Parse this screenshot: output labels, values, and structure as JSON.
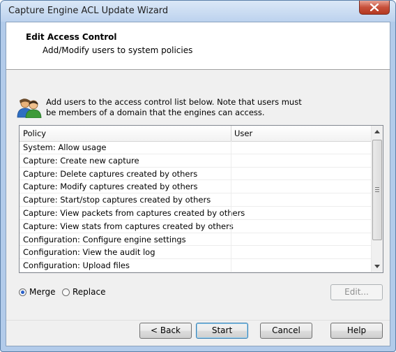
{
  "window": {
    "title": "Capture Engine ACL Update Wizard",
    "close_icon": "close-icon"
  },
  "header": {
    "title": "Edit Access Control",
    "subtitle": "Add/Modify users to system policies"
  },
  "info": {
    "icon": "users-icon",
    "text": "Add users to the access control list below. Note that users must be members of a domain that the engines can access."
  },
  "table": {
    "columns": [
      "Policy",
      "User"
    ],
    "rows": [
      {
        "policy": "System: Allow usage",
        "user": ""
      },
      {
        "policy": "Capture: Create new capture",
        "user": ""
      },
      {
        "policy": "Capture: Delete captures created by others",
        "user": ""
      },
      {
        "policy": "Capture: Modify captures created by others",
        "user": ""
      },
      {
        "policy": "Capture: Start/stop captures created by others",
        "user": ""
      },
      {
        "policy": "Capture: View packets from captures created by others",
        "user": ""
      },
      {
        "policy": "Capture: View stats from captures created by others",
        "user": ""
      },
      {
        "policy": "Configuration: Configure engine settings",
        "user": ""
      },
      {
        "policy": "Configuration: View the audit log",
        "user": ""
      },
      {
        "policy": "Configuration: Upload files",
        "user": ""
      }
    ]
  },
  "options": {
    "merge_label": "Merge",
    "replace_label": "Replace",
    "selected": "Merge"
  },
  "buttons": {
    "edit": "Edit...",
    "back": "< Back",
    "start": "Start",
    "cancel": "Cancel",
    "help": "Help"
  },
  "colors": {
    "title_bar": "#c2d7ef",
    "close_button": "#c7503a",
    "accent": "#2a60c8"
  }
}
